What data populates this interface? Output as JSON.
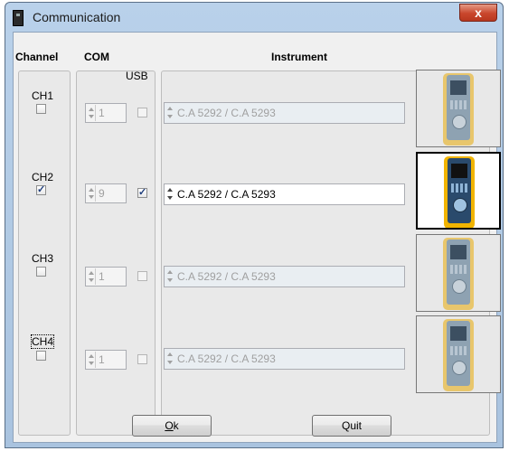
{
  "window": {
    "title": "Communication",
    "close_glyph": "x"
  },
  "headers": {
    "channel": "Channel",
    "com": "COM",
    "usb": "USB",
    "instrument": "Instrument"
  },
  "rows": [
    {
      "channel": "CH1",
      "channel_checked": false,
      "com": "1",
      "usb_checked": false,
      "instrument": "C.A 5292 / C.A 5293",
      "enabled": false
    },
    {
      "channel": "CH2",
      "channel_checked": true,
      "com": "9",
      "usb_checked": true,
      "instrument": "C.A 5292 / C.A 5293",
      "enabled": true
    },
    {
      "channel": "CH3",
      "channel_checked": false,
      "com": "1",
      "usb_checked": false,
      "instrument": "C.A 5292 / C.A 5293",
      "enabled": false
    },
    {
      "channel": "CH4",
      "channel_checked": false,
      "com": "1",
      "usb_checked": false,
      "instrument": "C.A 5292 / C.A 5293",
      "enabled": false
    }
  ],
  "buttons": {
    "ok_mnemonic": "O",
    "ok_rest": "k",
    "quit": "Quit"
  },
  "icons": {
    "window": "device-icon",
    "close": "close-icon",
    "instrument": "instrument-photo"
  }
}
